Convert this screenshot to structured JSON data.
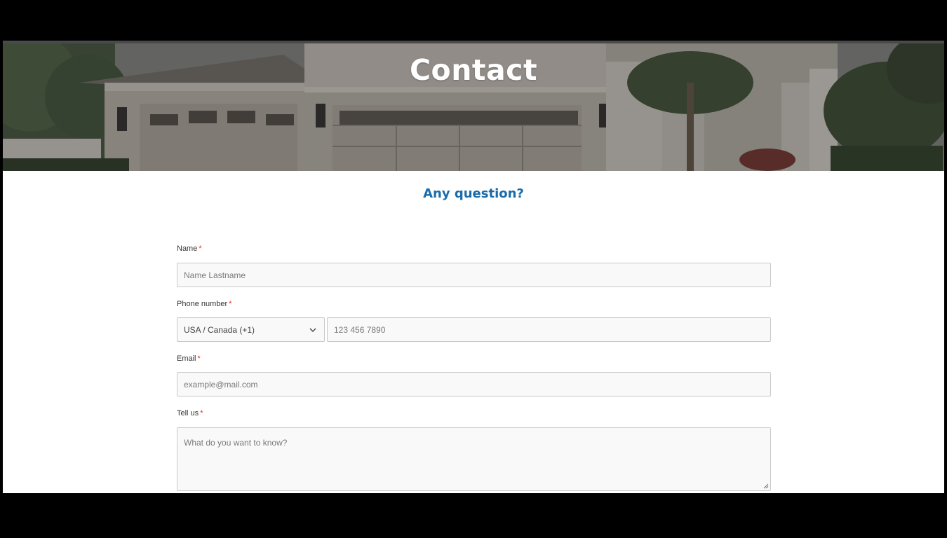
{
  "hero": {
    "title": "Contact"
  },
  "subtitle": "Any question?",
  "form": {
    "name": {
      "label": "Name",
      "required_mark": "*",
      "placeholder": "Name Lastname"
    },
    "phone": {
      "label": "Phone number",
      "required_mark": "*",
      "country_selected": "USA / Canada (+1)",
      "placeholder": "123 456 7890"
    },
    "email": {
      "label": "Email",
      "required_mark": "*",
      "placeholder": "example@mail.com"
    },
    "message": {
      "label": "Tell us",
      "required_mark": "*",
      "placeholder": "What do you want to know?"
    }
  },
  "colors": {
    "page_background": "#000000",
    "content_background": "#ffffff",
    "subtitle": "#1a6bab",
    "required": "#e0302a",
    "field_background": "#f9f9f9",
    "field_border": "#c9c9c9"
  }
}
